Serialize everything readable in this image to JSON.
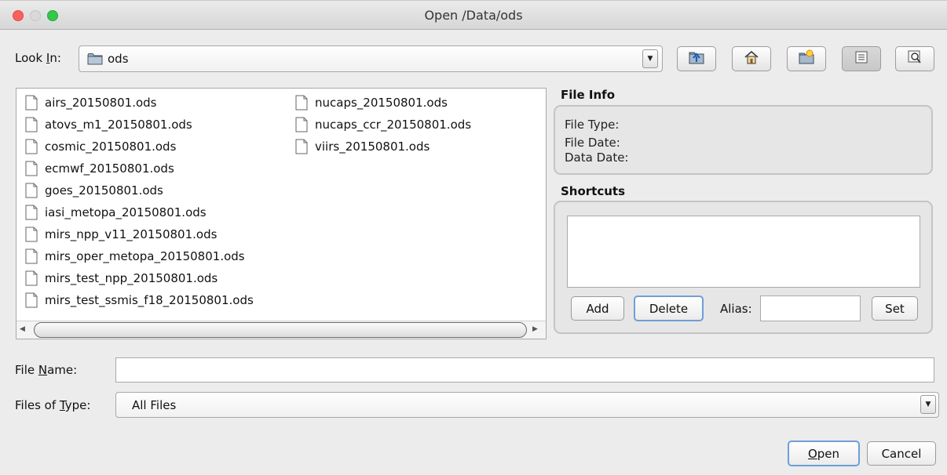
{
  "window": {
    "title": "Open  /Data/ods"
  },
  "look_in": {
    "label_pre": "Look ",
    "label_mnemonic": "I",
    "label_post": "n:",
    "value": "ods",
    "value_icon": "folder-icon"
  },
  "toolbar": {
    "buttons": [
      {
        "name": "up-one-level",
        "icon": "folder-up-icon"
      },
      {
        "name": "home",
        "icon": "home-icon"
      },
      {
        "name": "new-folder",
        "icon": "new-folder-icon"
      },
      {
        "name": "list-view",
        "icon": "list-view-icon",
        "pressed": true
      },
      {
        "name": "details-view",
        "icon": "details-view-icon"
      }
    ]
  },
  "files": {
    "column1": [
      "airs_20150801.ods",
      "atovs_m1_20150801.ods",
      "cosmic_20150801.ods",
      "ecmwf_20150801.ods",
      "goes_20150801.ods",
      "iasi_metopa_20150801.ods",
      "mirs_npp_v11_20150801.ods",
      "mirs_oper_metopa_20150801.ods",
      "mirs_test_npp_20150801.ods",
      "mirs_test_ssmis_f18_20150801.ods"
    ],
    "column2": [
      "nucaps_20150801.ods",
      "nucaps_ccr_20150801.ods",
      "viirs_20150801.ods"
    ]
  },
  "file_info": {
    "title": "File Info",
    "file_type_label": "File Type:",
    "file_date_label": "File Date:",
    "data_date_label": "Data Date:"
  },
  "shortcuts": {
    "title": "Shortcuts",
    "add_label": "Add",
    "delete_label": "Delete",
    "alias_label": "Alias:",
    "alias_value": "",
    "set_label": "Set"
  },
  "file_name": {
    "label_pre": "File ",
    "label_mnemonic": "N",
    "label_post": "ame:",
    "value": ""
  },
  "files_of_type": {
    "label_pre": "Files of ",
    "label_mnemonic": "T",
    "label_post": "ype:",
    "value": "All Files"
  },
  "actions": {
    "open_mnemonic": "O",
    "open_rest": "pen",
    "cancel_label": "Cancel"
  }
}
